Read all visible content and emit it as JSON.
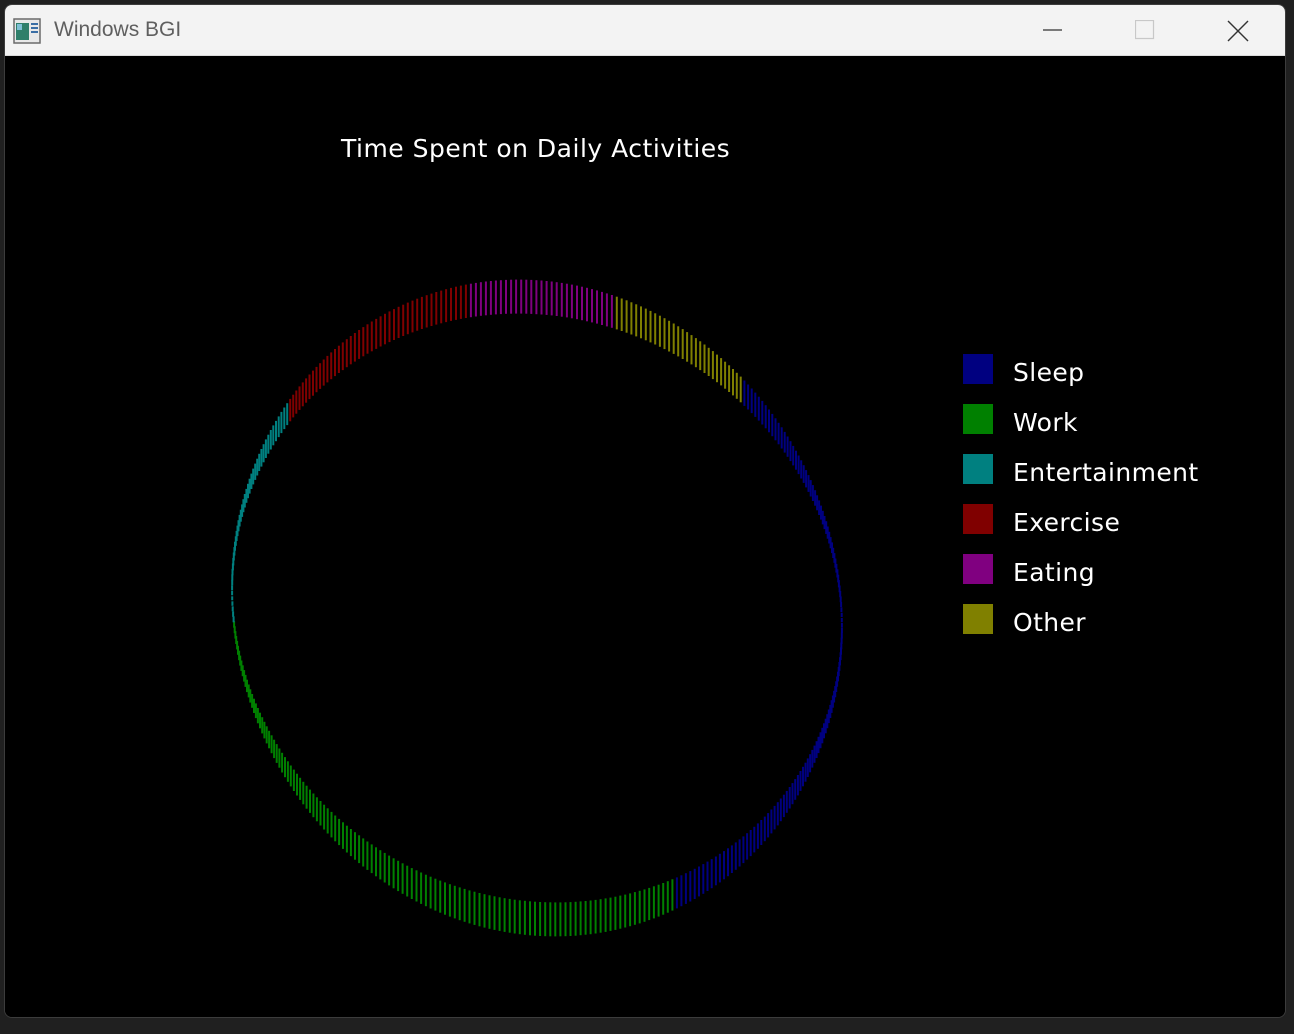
{
  "window": {
    "title": "Windows BGI",
    "icon": "bgi-app-icon",
    "controls": {
      "minimize": "minimize-icon",
      "maximize": "maximize-icon",
      "close": "close-icon"
    }
  },
  "chart_data": {
    "type": "pie",
    "title": "Time Spent on Daily Activities",
    "legend_position": "right",
    "categories": [
      "Sleep",
      "Work",
      "Entertainment",
      "Exercise",
      "Eating",
      "Other"
    ],
    "colors": [
      "#000080",
      "#008000",
      "#008080",
      "#800000",
      "#800080",
      "#808000"
    ],
    "values": [
      8,
      8,
      3,
      3,
      2,
      2
    ]
  }
}
